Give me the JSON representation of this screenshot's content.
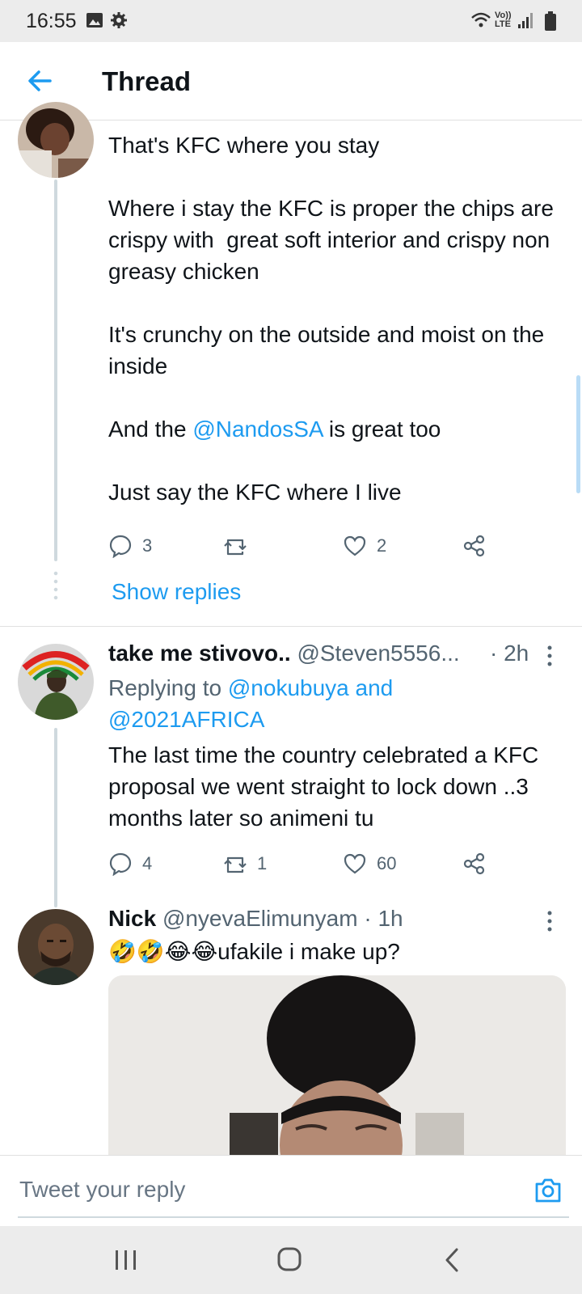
{
  "status": {
    "time": "16:55",
    "network": "Vo)) LTE"
  },
  "header": {
    "title": "Thread"
  },
  "tweet1": {
    "text_before": "That's KFC where you stay\n\nWhere i stay the KFC is proper the chips are crispy with  great soft interior and crispy non greasy chicken\n\nIt's crunchy on the outside and moist on the inside\n\nAnd the ",
    "mention": "@NandosSA",
    "text_after": " is great too\n\nJust say the KFC where I live",
    "replies": "3",
    "likes": "2",
    "show_replies": "Show replies"
  },
  "tweet2": {
    "name": "take me stivovo..",
    "handle": "@Steven5556...",
    "time": "· 2h",
    "replying_prefix": "Replying to ",
    "replying_to": "@nokubuya and @2021AFRICA",
    "text": "The last time the country celebrated a KFC proposal we went straight to lock down ..3 months later so animeni tu",
    "replies": "4",
    "retweets": "1",
    "likes": "60"
  },
  "tweet3": {
    "name": "Nick",
    "handle": "@nyevaElimunyam",
    "time": "· 1h",
    "emoji": "🤣🤣😂😂",
    "text": "ufakile i make up?"
  },
  "reply": {
    "placeholder": "Tweet your reply"
  },
  "colors": {
    "accent": "#1d9bf0",
    "text": "#0f1419",
    "muted": "#536471"
  }
}
